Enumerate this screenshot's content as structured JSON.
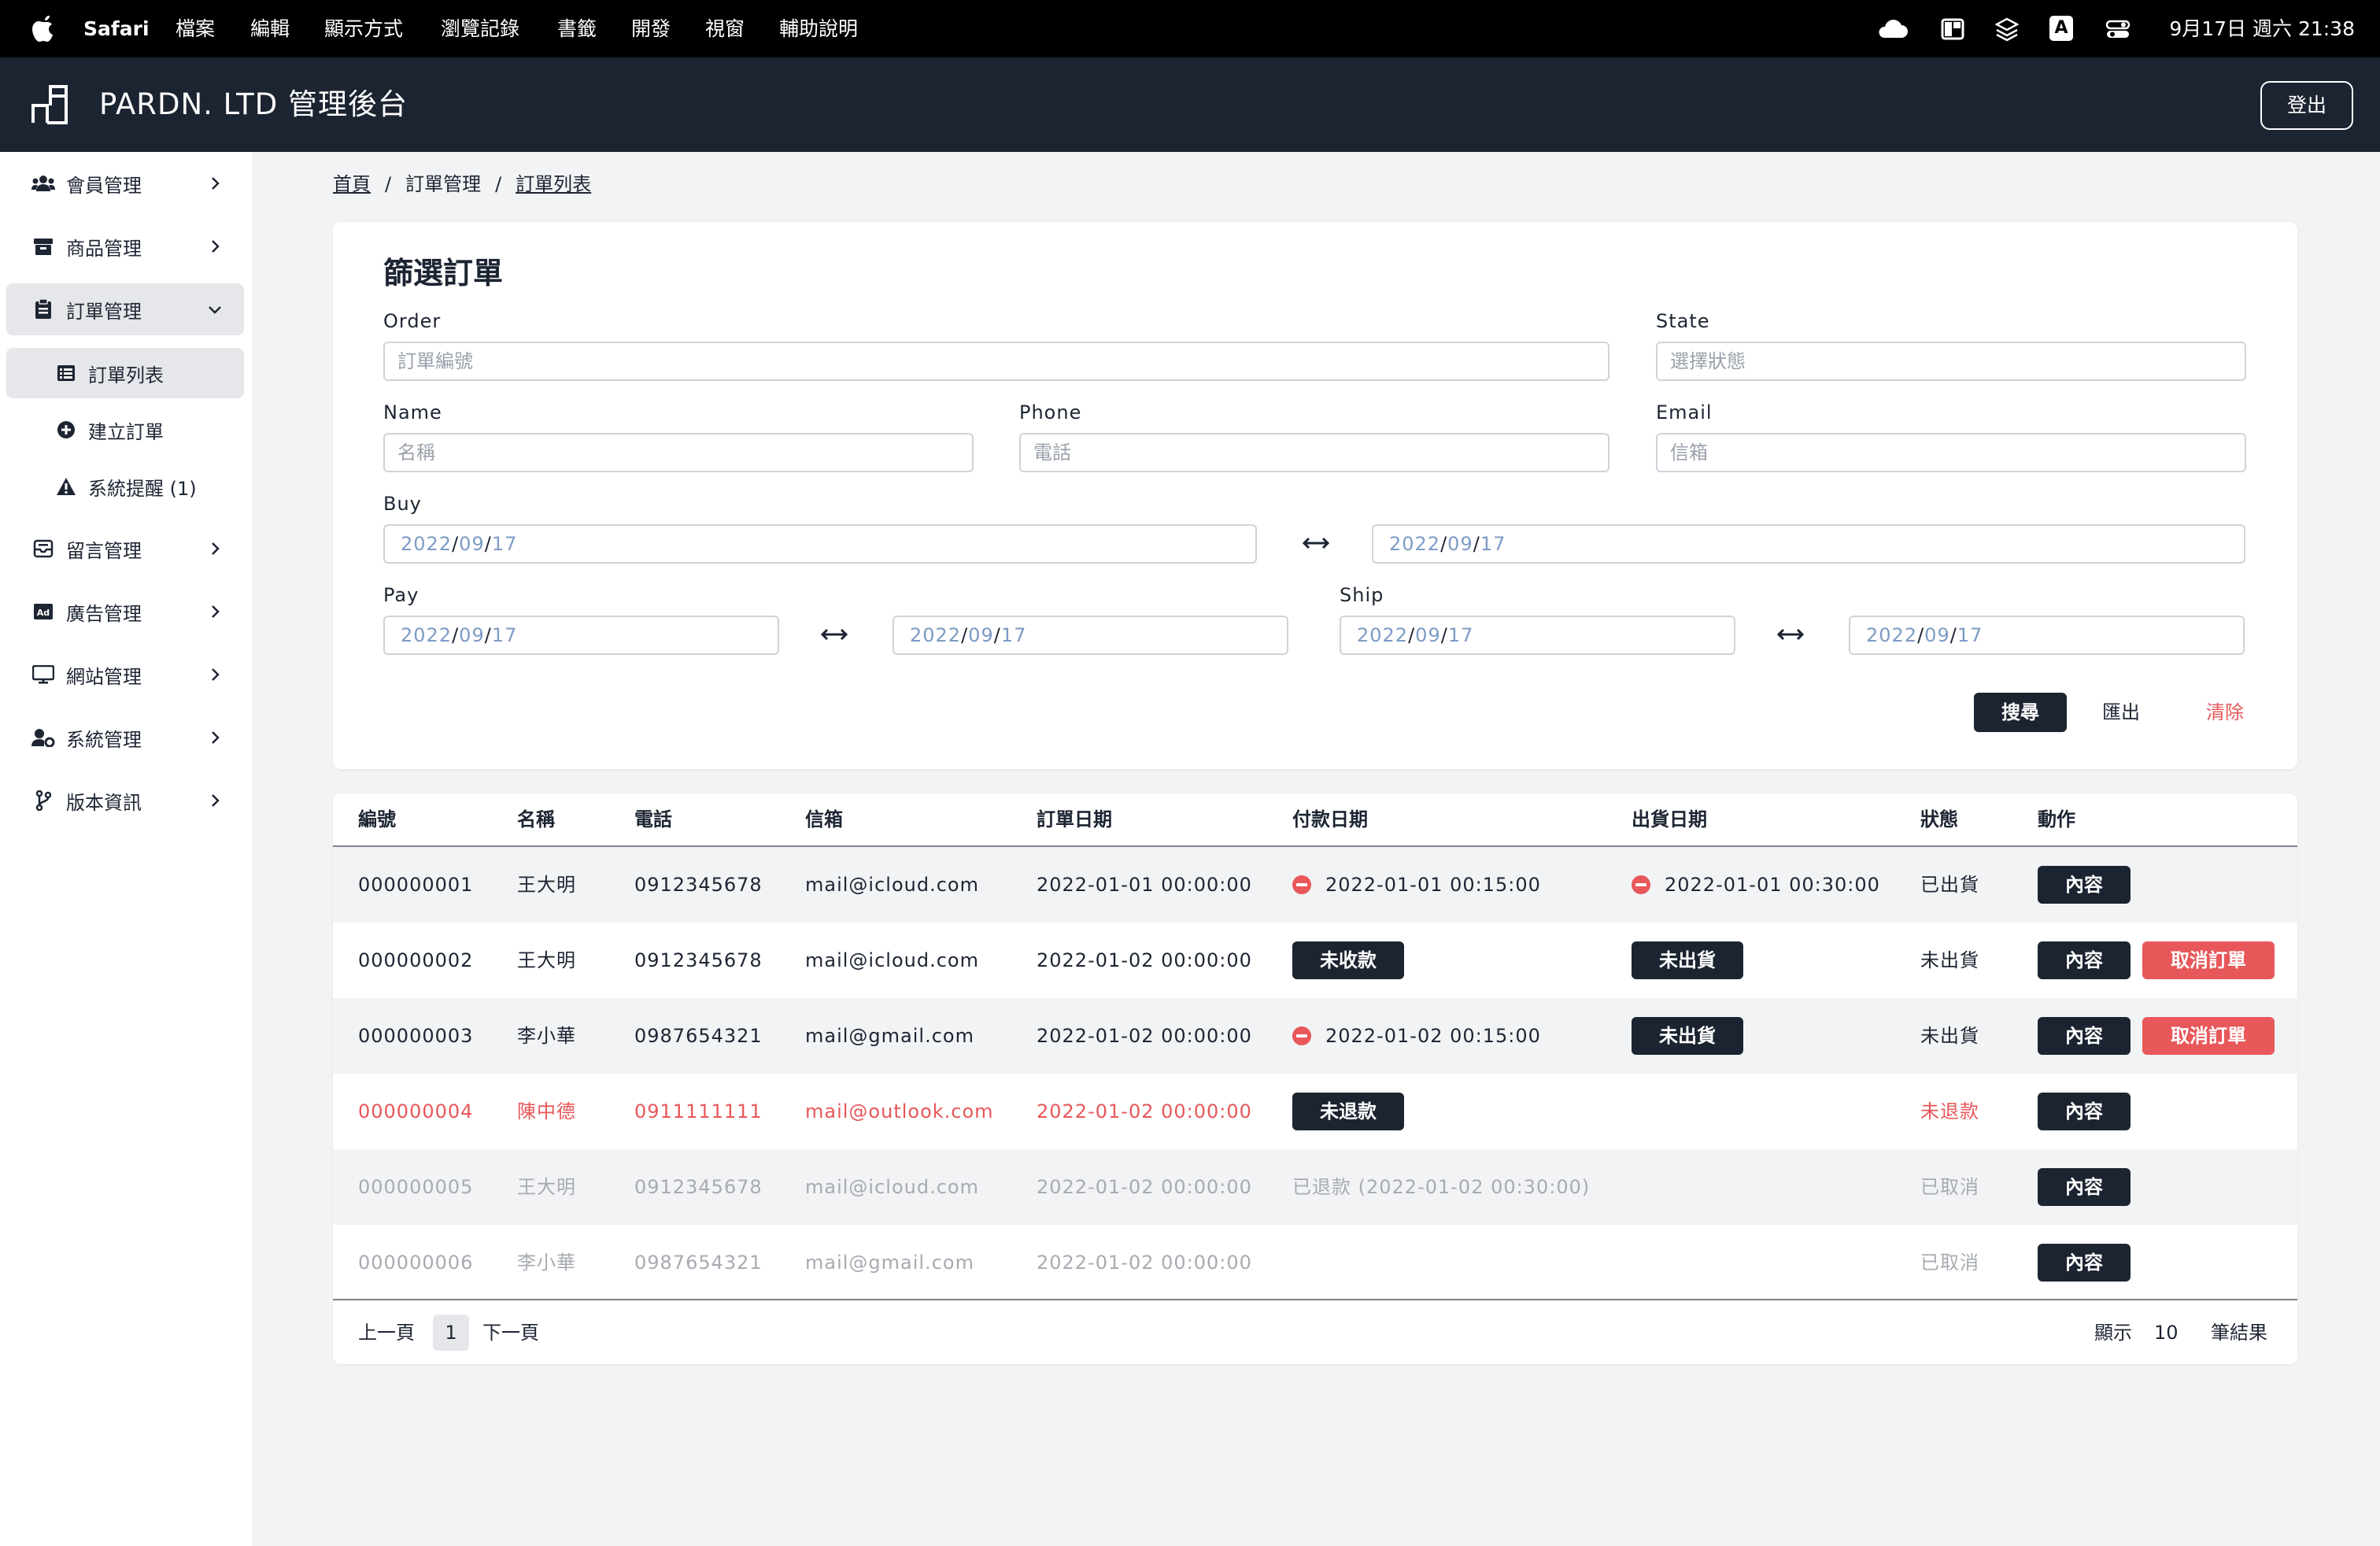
{
  "menubar": {
    "app": "Safari",
    "items": [
      "檔案",
      "編輯",
      "顯示方式",
      "瀏覽記錄",
      "書籤",
      "開發",
      "視窗",
      "輔助說明"
    ],
    "clock": "9月17日 週六 21:38",
    "input_method": "A"
  },
  "header": {
    "title": "PARDN. LTD 管理後台",
    "logout": "登出"
  },
  "sidebar": {
    "members": "會員管理",
    "products": "商品管理",
    "orders": "訂單管理",
    "order_list": "訂單列表",
    "create_order": "建立訂單",
    "system_alert": "系統提醒 (1)",
    "messages": "留言管理",
    "ads": "廣告管理",
    "website": "網站管理",
    "system": "系統管理",
    "version": "版本資訊"
  },
  "breadcrumb": {
    "home": "首頁",
    "orders": "訂單管理",
    "list": "訂單列表",
    "separator": "/"
  },
  "filter": {
    "title": "篩選訂單",
    "order_label": "Order",
    "order_placeholder": "訂單編號",
    "state_label": "State",
    "state_placeholder": "選擇狀態",
    "name_label": "Name",
    "name_placeholder": "名稱",
    "phone_label": "Phone",
    "phone_placeholder": "電話",
    "email_label": "Email",
    "email_placeholder": "信箱",
    "buy_label": "Buy",
    "pay_label": "Pay",
    "ship_label": "Ship",
    "date_year": "2022",
    "date_month": "09",
    "date_day": "17",
    "search": "搜尋",
    "export": "匯出",
    "clear": "清除"
  },
  "table": {
    "headers": {
      "id": "編號",
      "name": "名稱",
      "phone": "電話",
      "email": "信箱",
      "order_date": "訂單日期",
      "pay_date": "付款日期",
      "ship_date": "出貨日期",
      "state": "狀態",
      "action": "動作"
    },
    "rows": [
      {
        "id": "000000001",
        "name": "王大明",
        "phone": "0912345678",
        "email": "mail@icloud.com",
        "order_date": "2022-01-01 00:00:00",
        "pay": "2022-01-01 00:15:00",
        "ship": "2022-01-01 00:30:00",
        "state": "已出貨",
        "detail": "內容"
      },
      {
        "id": "000000002",
        "name": "王大明",
        "phone": "0912345678",
        "email": "mail@icloud.com",
        "order_date": "2022-01-02 00:00:00",
        "pay": "未收款",
        "ship": "未出貨",
        "state": "未出貨",
        "detail": "內容",
        "cancel": "取消訂單"
      },
      {
        "id": "000000003",
        "name": "李小華",
        "phone": "0987654321",
        "email": "mail@gmail.com",
        "order_date": "2022-01-02 00:00:00",
        "pay": "2022-01-02 00:15:00",
        "ship": "未出貨",
        "state": "未出貨",
        "detail": "內容",
        "cancel": "取消訂單"
      },
      {
        "id": "000000004",
        "name": "陳中德",
        "phone": "0911111111",
        "email": "mail@outlook.com",
        "order_date": "2022-01-02 00:00:00",
        "pay": "未退款",
        "state": "未退款",
        "detail": "內容"
      },
      {
        "id": "000000005",
        "name": "王大明",
        "phone": "0912345678",
        "email": "mail@icloud.com",
        "order_date": "2022-01-02 00:00:00",
        "pay": "已退款 (2022-01-02 00:30:00)",
        "state": "已取消",
        "detail": "內容"
      },
      {
        "id": "000000006",
        "name": "李小華",
        "phone": "0987654321",
        "email": "mail@gmail.com",
        "order_date": "2022-01-02 00:00:00",
        "state": "已取消",
        "detail": "內容"
      }
    ]
  },
  "pagination": {
    "prev": "上一頁",
    "current": "1",
    "next": "下一頁",
    "show_label": "顯示",
    "page_size": "10",
    "result_label": "筆結果"
  },
  "colors": {
    "dark": "#1c2431",
    "danger": "#e8575a",
    "muted": "#a7abb1",
    "date_blue": "#7d9bc4"
  }
}
